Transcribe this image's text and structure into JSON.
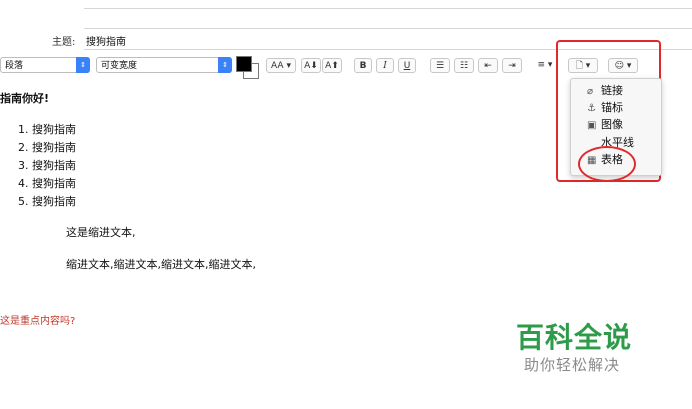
{
  "header": {
    "subject_label": "主题:",
    "subject_value": "搜狗指南"
  },
  "toolbar": {
    "paragraph_style": "段落",
    "font_width": "可变宽度",
    "font_size_btn": "AA ▾",
    "shrink_btn": "A⬇",
    "grow_btn": "A⬆",
    "bold": "B",
    "italic": "I",
    "underline": "U",
    "bullet_list": "☰",
    "number_list": "☷",
    "outdent": "⇤",
    "indent": "⇥",
    "align": "≡ ▾",
    "insert_menu": "🗋 ▾",
    "emoji_menu": "☺ ▾",
    "text_color": "#000000",
    "bg_color": "#ffffff"
  },
  "insert_menu": {
    "items": [
      {
        "label": "链接",
        "icon": "paperclip-icon",
        "glyph": "⌀"
      },
      {
        "label": "锚标",
        "icon": "anchor-icon",
        "glyph": "⚓"
      },
      {
        "label": "图像",
        "icon": "image-icon",
        "glyph": "▣"
      },
      {
        "label": "水平线",
        "icon": "",
        "glyph": ""
      },
      {
        "label": "表格",
        "icon": "table-icon",
        "glyph": "▦"
      }
    ]
  },
  "body": {
    "greeting": "指南你好!",
    "list": [
      "搜狗指南",
      "搜狗指南",
      "搜狗指南",
      "搜狗指南",
      "搜狗指南"
    ],
    "indent_line1": "这是缩进文本,",
    "indent_line2": "缩进文本,缩进文本,缩进文本,缩进文本,",
    "red_text": "这是重点内容吗?"
  },
  "watermark": {
    "title": "百科全说",
    "subtitle": "助你轻松解决"
  },
  "colors": {
    "accent_blue": "#3a82f7",
    "highlight_red": "#e02a2a",
    "emphasis_text": "#c0392b",
    "watermark_green": "#2e9b4a"
  }
}
